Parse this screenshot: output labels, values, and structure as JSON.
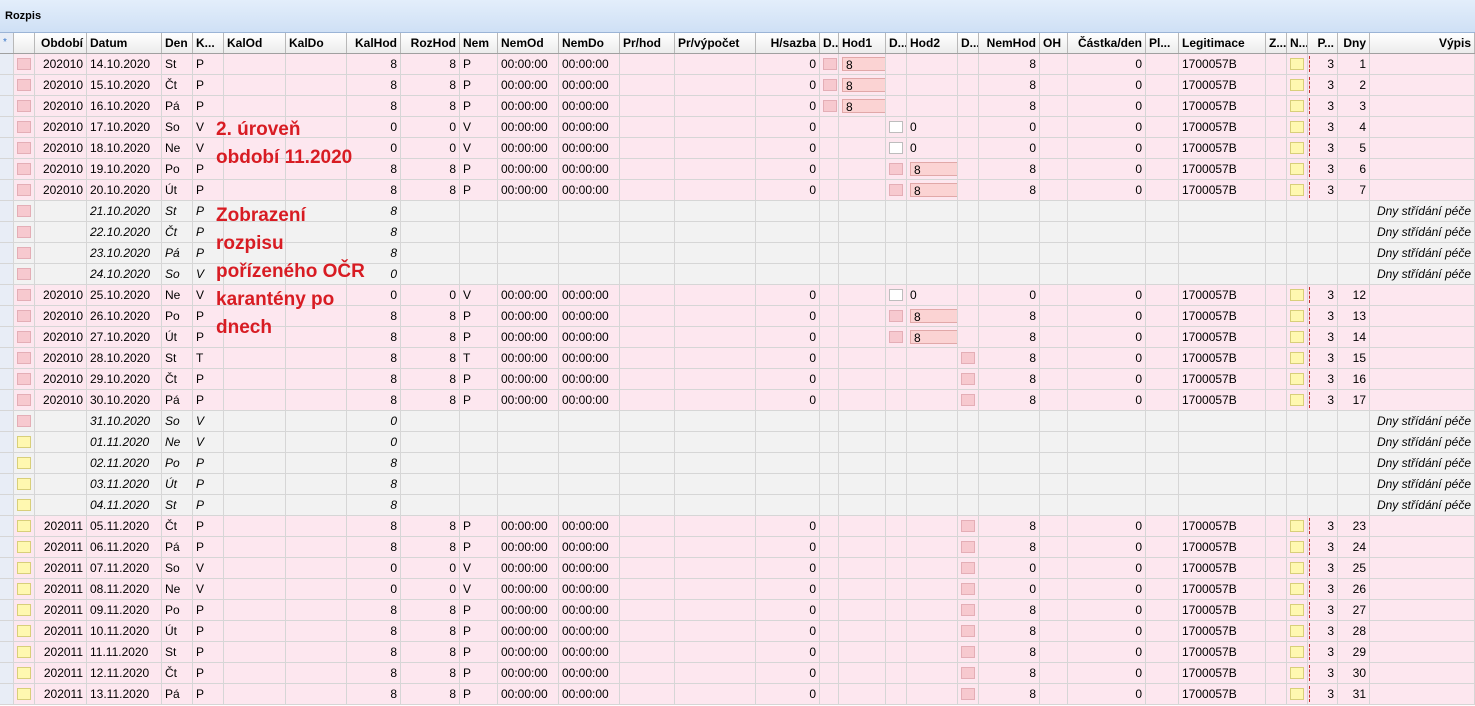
{
  "window": {
    "title": "Rozpis"
  },
  "columns": [
    {
      "key": "sel",
      "label": "*"
    },
    {
      "key": "flag",
      "label": ""
    },
    {
      "key": "obdobi",
      "label": "Období"
    },
    {
      "key": "datum",
      "label": "Datum"
    },
    {
      "key": "den",
      "label": "Den"
    },
    {
      "key": "k",
      "label": "K..."
    },
    {
      "key": "kalod",
      "label": "KalOd"
    },
    {
      "key": "kaldo",
      "label": "KalDo"
    },
    {
      "key": "kalhod",
      "label": "KalHod"
    },
    {
      "key": "rozhod",
      "label": "RozHod"
    },
    {
      "key": "nem",
      "label": "Nem"
    },
    {
      "key": "nemod",
      "label": "NemOd"
    },
    {
      "key": "nemdo",
      "label": "NemDo"
    },
    {
      "key": "prhod",
      "label": "Pr/hod"
    },
    {
      "key": "prvypocet",
      "label": "Pr/výpočet"
    },
    {
      "key": "hsazba",
      "label": "H/sazba"
    },
    {
      "key": "d1",
      "label": "D..."
    },
    {
      "key": "hod1",
      "label": "Hod1"
    },
    {
      "key": "d2",
      "label": "D..."
    },
    {
      "key": "hod2",
      "label": "Hod2"
    },
    {
      "key": "d3",
      "label": "D..."
    },
    {
      "key": "nemhod",
      "label": "NemHod"
    },
    {
      "key": "oh",
      "label": "OH"
    },
    {
      "key": "castka",
      "label": "Částka/den"
    },
    {
      "key": "pl",
      "label": "Pl..."
    },
    {
      "key": "legit",
      "label": "Legitimace"
    },
    {
      "key": "z",
      "label": "Z..."
    },
    {
      "key": "n",
      "label": "N..."
    },
    {
      "key": "p",
      "label": "P..."
    },
    {
      "key": "dny",
      "label": "Dny"
    },
    {
      "key": "vypis",
      "label": "Výpis"
    }
  ],
  "rows": [
    {
      "type": "data",
      "flag": "pink",
      "obdobi": "202010",
      "datum": "14.10.2020",
      "den": "St",
      "k": "P",
      "kalhod": "8",
      "rozhod": "8",
      "nem": "P",
      "nemod": "00:00:00",
      "nemdo": "00:00:00",
      "hsazba": "0",
      "d1": "pink",
      "hod1": "8",
      "d2": "",
      "hod2": "",
      "d3": "",
      "nemhod": "8",
      "castka": "0",
      "legit": "1700057B",
      "n": "yellow",
      "p": "3",
      "dny": "1"
    },
    {
      "type": "data",
      "flag": "pink",
      "obdobi": "202010",
      "datum": "15.10.2020",
      "den": "Čt",
      "k": "P",
      "kalhod": "8",
      "rozhod": "8",
      "nem": "P",
      "nemod": "00:00:00",
      "nemdo": "00:00:00",
      "hsazba": "0",
      "d1": "pink",
      "hod1": "8",
      "d2": "",
      "hod2": "",
      "d3": "",
      "nemhod": "8",
      "castka": "0",
      "legit": "1700057B",
      "n": "yellow",
      "p": "3",
      "dny": "2"
    },
    {
      "type": "data",
      "flag": "pink",
      "obdobi": "202010",
      "datum": "16.10.2020",
      "den": "Pá",
      "k": "P",
      "kalhod": "8",
      "rozhod": "8",
      "nem": "P",
      "nemod": "00:00:00",
      "nemdo": "00:00:00",
      "hsazba": "0",
      "d1": "pink",
      "hod1": "8",
      "d2": "",
      "hod2": "",
      "d3": "",
      "nemhod": "8",
      "castka": "0",
      "legit": "1700057B",
      "n": "yellow",
      "p": "3",
      "dny": "3"
    },
    {
      "type": "data",
      "flag": "pink",
      "obdobi": "202010",
      "datum": "17.10.2020",
      "den": "So",
      "k": "V",
      "kalhod": "0",
      "rozhod": "0",
      "nem": "V",
      "nemod": "00:00:00",
      "nemdo": "00:00:00",
      "hsazba": "0",
      "d1": "",
      "hod1": "",
      "d2": "white",
      "hod2": "0",
      "d3": "",
      "nemhod": "0",
      "castka": "0",
      "legit": "1700057B",
      "n": "yellow",
      "p": "3",
      "dny": "4"
    },
    {
      "type": "data",
      "flag": "pink",
      "obdobi": "202010",
      "datum": "18.10.2020",
      "den": "Ne",
      "k": "V",
      "kalhod": "0",
      "rozhod": "0",
      "nem": "V",
      "nemod": "00:00:00",
      "nemdo": "00:00:00",
      "hsazba": "0",
      "d1": "",
      "hod1": "",
      "d2": "white",
      "hod2": "0",
      "d3": "",
      "nemhod": "0",
      "castka": "0",
      "legit": "1700057B",
      "n": "yellow",
      "p": "3",
      "dny": "5"
    },
    {
      "type": "data",
      "flag": "pink",
      "obdobi": "202010",
      "datum": "19.10.2020",
      "den": "Po",
      "k": "P",
      "kalhod": "8",
      "rozhod": "8",
      "nem": "P",
      "nemod": "00:00:00",
      "nemdo": "00:00:00",
      "hsazba": "0",
      "d1": "",
      "hod1": "",
      "d2": "pink",
      "hod2": "8",
      "d3": "",
      "nemhod": "8",
      "castka": "0",
      "legit": "1700057B",
      "n": "yellow",
      "p": "3",
      "dny": "6"
    },
    {
      "type": "data",
      "flag": "pink",
      "obdobi": "202010",
      "datum": "20.10.2020",
      "den": "Út",
      "k": "P",
      "kalhod": "8",
      "rozhod": "8",
      "nem": "P",
      "nemod": "00:00:00",
      "nemdo": "00:00:00",
      "hsazba": "0",
      "d1": "",
      "hod1": "",
      "d2": "pink",
      "hod2": "8",
      "d3": "",
      "nemhod": "8",
      "castka": "0",
      "legit": "1700057B",
      "n": "yellow",
      "p": "3",
      "dny": "7"
    },
    {
      "type": "gap",
      "flag": "pink",
      "datum": "21.10.2020",
      "den": "St",
      "k": "P",
      "kalhod": "8",
      "vypis": "Dny střídání péče"
    },
    {
      "type": "gap",
      "flag": "pink",
      "datum": "22.10.2020",
      "den": "Čt",
      "k": "P",
      "kalhod": "8",
      "vypis": "Dny střídání péče"
    },
    {
      "type": "gap",
      "flag": "pink",
      "datum": "23.10.2020",
      "den": "Pá",
      "k": "P",
      "kalhod": "8",
      "vypis": "Dny střídání péče"
    },
    {
      "type": "gap",
      "flag": "pink",
      "datum": "24.10.2020",
      "den": "So",
      "k": "V",
      "kalhod": "0",
      "vypis": "Dny střídání péče"
    },
    {
      "type": "data",
      "flag": "pink",
      "obdobi": "202010",
      "datum": "25.10.2020",
      "den": "Ne",
      "k": "V",
      "kalhod": "0",
      "rozhod": "0",
      "nem": "V",
      "nemod": "00:00:00",
      "nemdo": "00:00:00",
      "hsazba": "0",
      "d1": "",
      "hod1": "",
      "d2": "white",
      "hod2": "0",
      "d3": "",
      "nemhod": "0",
      "castka": "0",
      "legit": "1700057B",
      "n": "yellow",
      "p": "3",
      "dny": "12"
    },
    {
      "type": "data",
      "flag": "pink",
      "obdobi": "202010",
      "datum": "26.10.2020",
      "den": "Po",
      "k": "P",
      "kalhod": "8",
      "rozhod": "8",
      "nem": "P",
      "nemod": "00:00:00",
      "nemdo": "00:00:00",
      "hsazba": "0",
      "d1": "",
      "hod1": "",
      "d2": "pink",
      "hod2": "8",
      "d3": "",
      "nemhod": "8",
      "castka": "0",
      "legit": "1700057B",
      "n": "yellow",
      "p": "3",
      "dny": "13"
    },
    {
      "type": "data",
      "flag": "pink",
      "obdobi": "202010",
      "datum": "27.10.2020",
      "den": "Út",
      "k": "P",
      "kalhod": "8",
      "rozhod": "8",
      "nem": "P",
      "nemod": "00:00:00",
      "nemdo": "00:00:00",
      "hsazba": "0",
      "d1": "",
      "hod1": "",
      "d2": "pink",
      "hod2": "8",
      "d3": "",
      "nemhod": "8",
      "castka": "0",
      "legit": "1700057B",
      "n": "yellow",
      "p": "3",
      "dny": "14"
    },
    {
      "type": "data",
      "flag": "pink",
      "obdobi": "202010",
      "datum": "28.10.2020",
      "den": "St",
      "k": "T",
      "kalhod": "8",
      "rozhod": "8",
      "nem": "T",
      "nemod": "00:00:00",
      "nemdo": "00:00:00",
      "hsazba": "0",
      "d1": "",
      "hod1": "",
      "d2": "",
      "hod2": "",
      "d3": "pink",
      "nemhod": "8",
      "castka": "0",
      "legit": "1700057B",
      "n": "yellow",
      "p": "3",
      "dny": "15"
    },
    {
      "type": "data",
      "flag": "pink",
      "obdobi": "202010",
      "datum": "29.10.2020",
      "den": "Čt",
      "k": "P",
      "kalhod": "8",
      "rozhod": "8",
      "nem": "P",
      "nemod": "00:00:00",
      "nemdo": "00:00:00",
      "hsazba": "0",
      "d1": "",
      "hod1": "",
      "d2": "",
      "hod2": "",
      "d3": "pink",
      "nemhod": "8",
      "castka": "0",
      "legit": "1700057B",
      "n": "yellow",
      "p": "3",
      "dny": "16"
    },
    {
      "type": "data",
      "flag": "pink",
      "obdobi": "202010",
      "datum": "30.10.2020",
      "den": "Pá",
      "k": "P",
      "kalhod": "8",
      "rozhod": "8",
      "nem": "P",
      "nemod": "00:00:00",
      "nemdo": "00:00:00",
      "hsazba": "0",
      "d1": "",
      "hod1": "",
      "d2": "",
      "hod2": "",
      "d3": "pink",
      "nemhod": "8",
      "castka": "0",
      "legit": "1700057B",
      "n": "yellow",
      "p": "3",
      "dny": "17"
    },
    {
      "type": "gap",
      "flag": "pink",
      "datum": "31.10.2020",
      "den": "So",
      "k": "V",
      "kalhod": "0",
      "vypis": "Dny střídání péče"
    },
    {
      "type": "gap",
      "flag": "yellow",
      "datum": "01.11.2020",
      "den": "Ne",
      "k": "V",
      "kalhod": "0",
      "vypis": "Dny střídání péče"
    },
    {
      "type": "gap",
      "flag": "yellow",
      "datum": "02.11.2020",
      "den": "Po",
      "k": "P",
      "kalhod": "8",
      "vypis": "Dny střídání péče"
    },
    {
      "type": "gap",
      "flag": "yellow",
      "datum": "03.11.2020",
      "den": "Út",
      "k": "P",
      "kalhod": "8",
      "vypis": "Dny střídání péče"
    },
    {
      "type": "gap",
      "flag": "yellow",
      "datum": "04.11.2020",
      "den": "St",
      "k": "P",
      "kalhod": "8",
      "vypis": "Dny střídání péče"
    },
    {
      "type": "data",
      "flag": "yellow",
      "obdobi": "202011",
      "datum": "05.11.2020",
      "den": "Čt",
      "k": "P",
      "kalhod": "8",
      "rozhod": "8",
      "nem": "P",
      "nemod": "00:00:00",
      "nemdo": "00:00:00",
      "hsazba": "0",
      "d1": "",
      "hod1": "",
      "d2": "",
      "hod2": "",
      "d3": "pink",
      "nemhod": "8",
      "castka": "0",
      "legit": "1700057B",
      "n": "yellow",
      "p": "3",
      "dny": "23"
    },
    {
      "type": "data",
      "flag": "yellow",
      "obdobi": "202011",
      "datum": "06.11.2020",
      "den": "Pá",
      "k": "P",
      "kalhod": "8",
      "rozhod": "8",
      "nem": "P",
      "nemod": "00:00:00",
      "nemdo": "00:00:00",
      "hsazba": "0",
      "d1": "",
      "hod1": "",
      "d2": "",
      "hod2": "",
      "d3": "pink",
      "nemhod": "8",
      "castka": "0",
      "legit": "1700057B",
      "n": "yellow",
      "p": "3",
      "dny": "24"
    },
    {
      "type": "data",
      "flag": "yellow",
      "obdobi": "202011",
      "datum": "07.11.2020",
      "den": "So",
      "k": "V",
      "kalhod": "0",
      "rozhod": "0",
      "nem": "V",
      "nemod": "00:00:00",
      "nemdo": "00:00:00",
      "hsazba": "0",
      "d1": "",
      "hod1": "",
      "d2": "",
      "hod2": "",
      "d3": "pink",
      "nemhod": "0",
      "castka": "0",
      "legit": "1700057B",
      "n": "yellow",
      "p": "3",
      "dny": "25"
    },
    {
      "type": "data",
      "flag": "yellow",
      "obdobi": "202011",
      "datum": "08.11.2020",
      "den": "Ne",
      "k": "V",
      "kalhod": "0",
      "rozhod": "0",
      "nem": "V",
      "nemod": "00:00:00",
      "nemdo": "00:00:00",
      "hsazba": "0",
      "d1": "",
      "hod1": "",
      "d2": "",
      "hod2": "",
      "d3": "pink",
      "nemhod": "0",
      "castka": "0",
      "legit": "1700057B",
      "n": "yellow",
      "p": "3",
      "dny": "26"
    },
    {
      "type": "data",
      "flag": "yellow",
      "obdobi": "202011",
      "datum": "09.11.2020",
      "den": "Po",
      "k": "P",
      "kalhod": "8",
      "rozhod": "8",
      "nem": "P",
      "nemod": "00:00:00",
      "nemdo": "00:00:00",
      "hsazba": "0",
      "d1": "",
      "hod1": "",
      "d2": "",
      "hod2": "",
      "d3": "pink",
      "nemhod": "8",
      "castka": "0",
      "legit": "1700057B",
      "n": "yellow",
      "p": "3",
      "dny": "27"
    },
    {
      "type": "data",
      "flag": "yellow",
      "obdobi": "202011",
      "datum": "10.11.2020",
      "den": "Út",
      "k": "P",
      "kalhod": "8",
      "rozhod": "8",
      "nem": "P",
      "nemod": "00:00:00",
      "nemdo": "00:00:00",
      "hsazba": "0",
      "d1": "",
      "hod1": "",
      "d2": "",
      "hod2": "",
      "d3": "pink",
      "nemhod": "8",
      "castka": "0",
      "legit": "1700057B",
      "n": "yellow",
      "p": "3",
      "dny": "28"
    },
    {
      "type": "data",
      "flag": "yellow",
      "obdobi": "202011",
      "datum": "11.11.2020",
      "den": "St",
      "k": "P",
      "kalhod": "8",
      "rozhod": "8",
      "nem": "P",
      "nemod": "00:00:00",
      "nemdo": "00:00:00",
      "hsazba": "0",
      "d1": "",
      "hod1": "",
      "d2": "",
      "hod2": "",
      "d3": "pink",
      "nemhod": "8",
      "castka": "0",
      "legit": "1700057B",
      "n": "yellow",
      "p": "3",
      "dny": "29"
    },
    {
      "type": "data",
      "flag": "yellow",
      "obdobi": "202011",
      "datum": "12.11.2020",
      "den": "Čt",
      "k": "P",
      "kalhod": "8",
      "rozhod": "8",
      "nem": "P",
      "nemod": "00:00:00",
      "nemdo": "00:00:00",
      "hsazba": "0",
      "d1": "",
      "hod1": "",
      "d2": "",
      "hod2": "",
      "d3": "pink",
      "nemhod": "8",
      "castka": "0",
      "legit": "1700057B",
      "n": "yellow",
      "p": "3",
      "dny": "30"
    },
    {
      "type": "data",
      "flag": "yellow",
      "obdobi": "202011",
      "datum": "13.11.2020",
      "den": "Pá",
      "k": "P",
      "kalhod": "8",
      "rozhod": "8",
      "nem": "P",
      "nemod": "00:00:00",
      "nemdo": "00:00:00",
      "hsazba": "0",
      "d1": "",
      "hod1": "",
      "d2": "",
      "hod2": "",
      "d3": "pink",
      "nemhod": "8",
      "castka": "0",
      "legit": "1700057B",
      "n": "yellow",
      "p": "3",
      "dny": "31"
    }
  ],
  "annotations": {
    "level": [
      "2. úroveň",
      "období 11.2020"
    ],
    "display": [
      "Zobrazení",
      "rozpisu",
      "pořízeného OČR",
      "karantény po",
      "dnech"
    ]
  },
  "colors": {
    "annotation": "#d81c23",
    "data_row": "#fde7ef",
    "gap_row": "#f2f2f2"
  }
}
